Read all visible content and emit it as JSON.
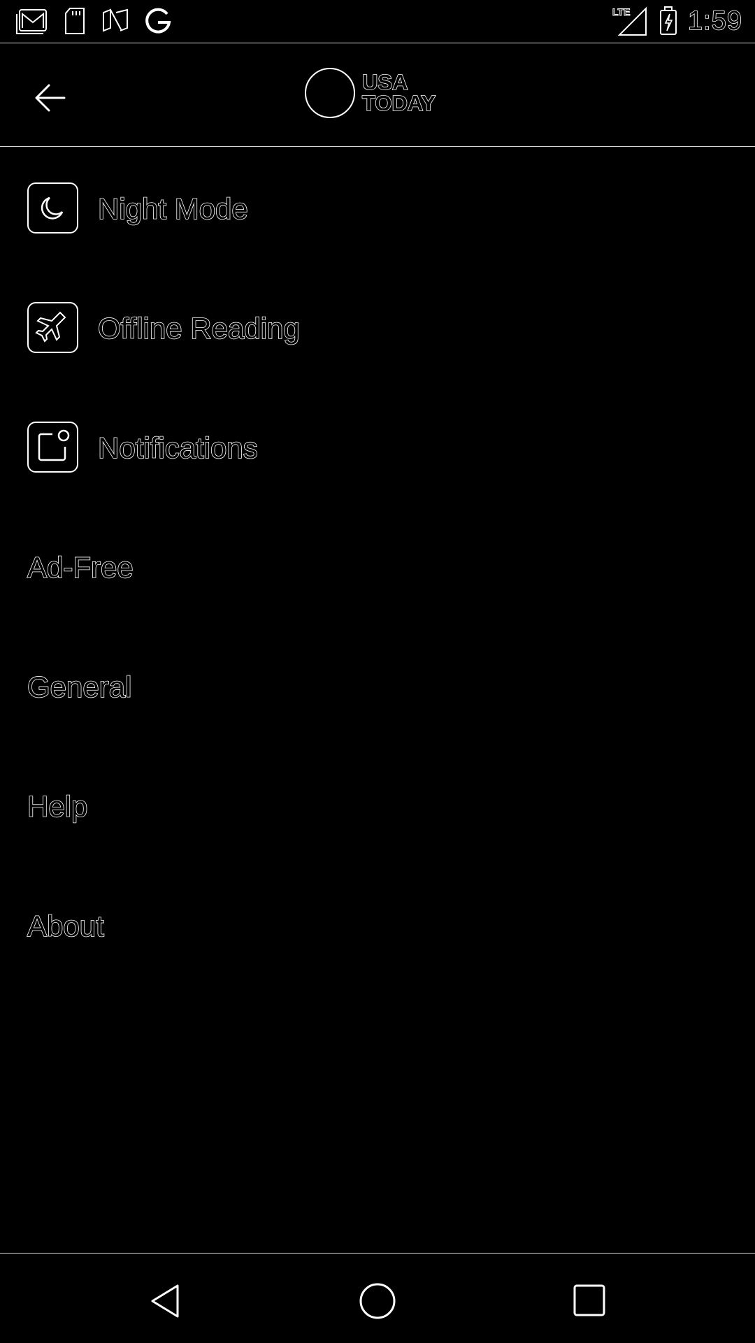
{
  "status_bar": {
    "time": "1:59",
    "left_icons": [
      "gmail-icon",
      "sd-card-icon",
      "news-icon",
      "google-icon"
    ],
    "right_icons": [
      "lte-signal-icon",
      "battery-charging-icon"
    ]
  },
  "app_bar": {
    "brand_line1": "USA",
    "brand_line2": "TODAY"
  },
  "menu": {
    "items": [
      {
        "label": "Night Mode",
        "icon": "moon-icon"
      },
      {
        "label": "Offline Reading",
        "icon": "airplane-icon"
      },
      {
        "label": "Notifications",
        "icon": "notification-icon"
      },
      {
        "label": "Ad-Free"
      },
      {
        "label": "General"
      },
      {
        "label": "Help"
      },
      {
        "label": "About"
      }
    ]
  },
  "nav_bar": {
    "buttons": [
      "back-triangle-icon",
      "home-circle-icon",
      "recents-square-icon"
    ]
  }
}
